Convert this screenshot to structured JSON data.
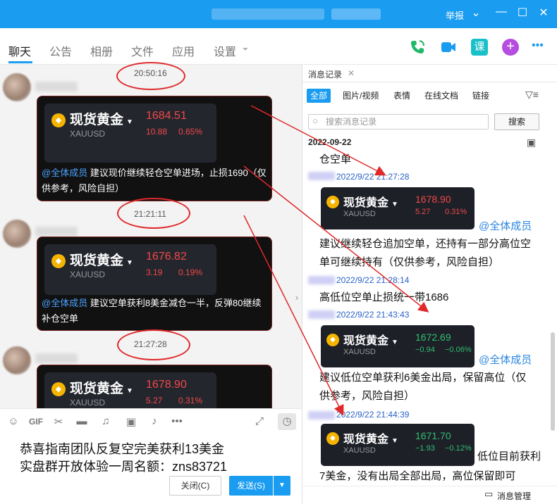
{
  "titlebar": {
    "report_label": "举报",
    "minimize": "—",
    "maximize": "☐",
    "close": "✕"
  },
  "tabs": [
    {
      "label": "聊天",
      "active": true
    },
    {
      "label": "公告",
      "active": false
    },
    {
      "label": "相册",
      "active": false
    },
    {
      "label": "文件",
      "active": false
    },
    {
      "label": "应用",
      "active": false
    },
    {
      "label": "设置",
      "active": false
    }
  ],
  "settings_caret": "⌄",
  "tab_icons": [
    "phone-icon",
    "video-icon",
    "lesson-icon",
    "add-app-icon",
    "more-icon"
  ],
  "lesson_label": "课",
  "more_label": "•••",
  "chat": {
    "timestamps": [
      "20:50:16",
      "21:21:11",
      "21:27:28"
    ],
    "messages": [
      {
        "card": {
          "name": "现货黄金",
          "symbol": "XAUUSD",
          "price": "1684.51",
          "change": "10.88",
          "percent": "0.65%",
          "direction": "up"
        },
        "mention": "@全体成员",
        "text_line1": "建议现价继续轻仓空单进场，止损1690（仅",
        "text_line2": "供参考，风险自担）"
      },
      {
        "card": {
          "name": "现货黄金",
          "symbol": "XAUUSD",
          "price": "1676.82",
          "change": "3.19",
          "percent": "0.19%",
          "direction": "up"
        },
        "mention": "@全体成员",
        "text_line1": "建议空单获利8美金减仓一半，反弹80继续",
        "text_line2": "补仓空单"
      },
      {
        "card": {
          "name": "现货黄金",
          "symbol": "XAUUSD",
          "price": "1678.90",
          "change": "5.27",
          "percent": "0.31%",
          "direction": "up"
        }
      }
    ],
    "collapse_glyph": "›"
  },
  "toolbar": {
    "emoji": "☺",
    "gif": "GIF",
    "scissors": "✂",
    "folder": "▬",
    "music": "♫",
    "image": "▣",
    "bell": "♪",
    "more": "•••",
    "expand": "⤢",
    "history": "◷"
  },
  "compose": {
    "line1": "恭喜指南团队反复空完美获利13美金",
    "line2": "实盘群开放体验一周名额：zns83721",
    "close_label": "关闭(C)",
    "send_label": "发送(S)",
    "send_arrow": "▼"
  },
  "history": {
    "tab_label": "消息记录",
    "tab_close": "✕",
    "filters": [
      "全部",
      "图片/视频",
      "表情",
      "在线文档",
      "链接"
    ],
    "filter_glyph": "▽≡",
    "search_placeholder": "搜索消息记录",
    "search_glyph": "○",
    "search_button": "搜索",
    "date": "2022-09-22",
    "calendar_glyph": "▣",
    "entries": {
      "line_kongdan": "仓空单",
      "time1": "2022/9/22 21:27:28",
      "card1": {
        "name": "现货黄金",
        "symbol": "XAUUSD",
        "price": "1678.90",
        "change": "5.27",
        "percent": "0.31%"
      },
      "mention1": "@全体成员",
      "text1_line1": "建议继续轻仓追加空单，还持有一部分高位空",
      "text1_line2": "单可继续持有（仅供参考，风险自担）",
      "time2": "2022/9/22 21:28:14",
      "text2": "高低位空单止损统一带1686",
      "time3": "2022/9/22 21:43:43",
      "card2": {
        "name": "现货黄金",
        "symbol": "XAUUSD",
        "price": "1672.69",
        "change": "−0.94",
        "percent": "−0.06%"
      },
      "mention2": "@全体成员",
      "text3_line1": "建议低位空单获利6美金出局，保留高位（仅",
      "text3_line2": "供参考，风险自担）",
      "time4": "2022/9/22 21:44:39",
      "card3": {
        "name": "现货黄金",
        "symbol": "XAUUSD",
        "price": "1671.70",
        "change": "−1.93",
        "percent": "−0.12%"
      },
      "text4_side": "低位目前获利",
      "text4_line2": "7美金，没有出局全部出局，高位保留即可"
    },
    "manage_label": "消息管理",
    "manage_glyph": "▭"
  },
  "colors": {
    "accent": "#1a9cf0",
    "annotation_red": "#e0292b",
    "price_up": "#f04848",
    "price_down": "#2fbf71"
  }
}
